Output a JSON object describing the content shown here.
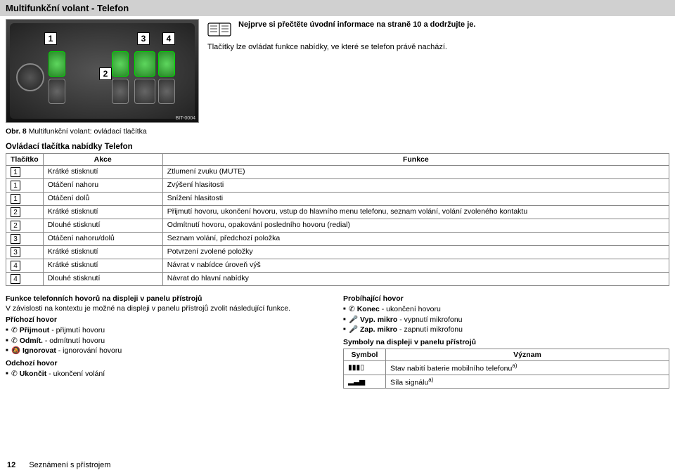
{
  "header": "Multifunkční volant - Telefon",
  "info": {
    "line1": "Nejprve si přečtěte úvodní informace na straně 10 a dodržujte je.",
    "line2": "Tlačítky lze ovládat funkce nabídky, ve které se telefon právě nachází."
  },
  "figure": {
    "callouts": [
      "1",
      "2",
      "3",
      "4"
    ],
    "refcode": "BIT-0004",
    "caption_prefix": "Obr. 8 ",
    "caption": "Multifunkční volant: ovládací tlačítka"
  },
  "table": {
    "title": "Ovládací tlačítka nabídky Telefon",
    "headers": {
      "button": "Tlačítko",
      "action": "Akce",
      "function": "Funkce"
    },
    "rows": [
      {
        "btn": "1",
        "action": "Krátké stisknutí",
        "func": "Ztlumení zvuku (MUTE)"
      },
      {
        "btn": "1",
        "action": "Otáčení nahoru",
        "func": "Zvýšení hlasitosti"
      },
      {
        "btn": "1",
        "action": "Otáčení dolů",
        "func": "Snížení hlasitosti"
      },
      {
        "btn": "2",
        "action": "Krátké stisknutí",
        "func": "Přijmutí hovoru, ukončení hovoru, vstup do hlavního menu telefonu, seznam volání, volání zvoleného kontaktu"
      },
      {
        "btn": "2",
        "action": "Dlouhé stisknutí",
        "func": "Odmítnutí hovoru, opakování posledního hovoru (redial)"
      },
      {
        "btn": "3",
        "action": "Otáčení nahoru/dolů",
        "func": "Seznam volání, předchozí položka"
      },
      {
        "btn": "3",
        "action": "Krátké stisknutí",
        "func": "Potvrzení zvolené položky"
      },
      {
        "btn": "4",
        "action": "Krátké stisknutí",
        "func": "Návrat v nabídce úroveň výš"
      },
      {
        "btn": "4",
        "action": "Dlouhé stisknutí",
        "func": "Návrat do hlavní nabídky"
      }
    ]
  },
  "left": {
    "head1": "Funkce telefonních hovorů na displeji v panelu přístrojů",
    "body1": "V závislosti na kontextu je možné na displeji v panelu přístrojů zvolit následující funkce.",
    "incoming": "Příchozí hovor",
    "incoming_items": [
      {
        "icon": "✆",
        "bold": "Přijmout",
        "rest": " - přijmutí hovoru"
      },
      {
        "icon": "✆",
        "bold": "Odmít.",
        "rest": " - odmítnutí hovoru"
      },
      {
        "icon": "🔕",
        "bold": "Ignorovat",
        "rest": " - ignorování hovoru"
      }
    ],
    "outgoing": "Odchozí hovor",
    "outgoing_items": [
      {
        "icon": "✆",
        "bold": "Ukončit",
        "rest": " - ukončení volání"
      }
    ]
  },
  "right": {
    "ongoing": "Probíhající hovor",
    "ongoing_items": [
      {
        "icon": "✆",
        "bold": "Konec",
        "rest": " - ukončení hovoru"
      },
      {
        "icon": "🎤",
        "bold": "Vyp. mikro",
        "rest": " - vypnutí mikrofonu"
      },
      {
        "icon": "🎤",
        "bold": "Zap. mikro",
        "rest": " - zapnutí mikrofonu"
      }
    ],
    "symbols_head": "Symboly na displeji v panelu přístrojů",
    "sym_headers": {
      "symbol": "Symbol",
      "meaning": "Význam"
    },
    "sym_rows": [
      {
        "icon": "▮▮▮▯",
        "text": "Stav nabití baterie mobilního telefonu",
        "sup": "a)"
      },
      {
        "icon": "▂▃▅",
        "text": "Síla signálu",
        "sup": "a)"
      }
    ]
  },
  "footer": {
    "page": "12",
    "section": "Seznámení s přístrojem"
  }
}
